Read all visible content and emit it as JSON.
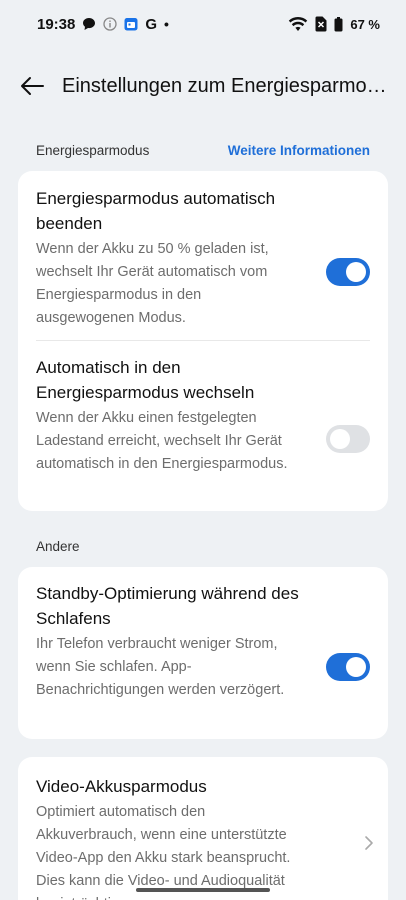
{
  "status": {
    "time": "19:38",
    "left_icons": [
      "chat-bubble-icon",
      "info-icon",
      "calendar-icon",
      "google-g-icon",
      "dot-icon"
    ],
    "google_label": "G",
    "dot": "•",
    "battery_percent": "67 %"
  },
  "header": {
    "title": "Einstellungen zum Energiesparmodus"
  },
  "sections": {
    "energy": {
      "label": "Energiesparmodus",
      "link": "Weitere Informationen"
    },
    "other": {
      "label": "Andere"
    }
  },
  "settings": {
    "auto_exit": {
      "title": "Energiesparmodus automatisch beenden",
      "description": "Wenn der Akku zu 50 % geladen ist, wechselt Ihr Gerät automatisch vom Energiesparmodus in den ausgewogenen Modus.",
      "enabled": true
    },
    "auto_enter": {
      "title": "Automatisch in den Energiesparmodus wechseln",
      "description": "Wenn der Akku einen festgelegten Ladestand erreicht, wechselt Ihr Gerät automatisch in den Energiesparmodus.",
      "enabled": false
    },
    "standby": {
      "title": "Standby-Optimierung während des Schlafens",
      "description": "Ihr Telefon verbraucht weniger Strom, wenn Sie schlafen. App-Benachrichtigungen werden verzögert.",
      "enabled": true
    },
    "video": {
      "title": "Video-Akkusparmodus",
      "description": "Optimiert automatisch den Akkuverbrauch, wenn eine unterstützte Video-App den Akku stark beansprucht. Dies kann die Video- und Audioqualität beeinträchtigen."
    }
  },
  "colors": {
    "accent": "#1f6fd8",
    "background": "#eef1f4",
    "card": "#ffffff",
    "toggle_off": "#dfe1e4"
  }
}
